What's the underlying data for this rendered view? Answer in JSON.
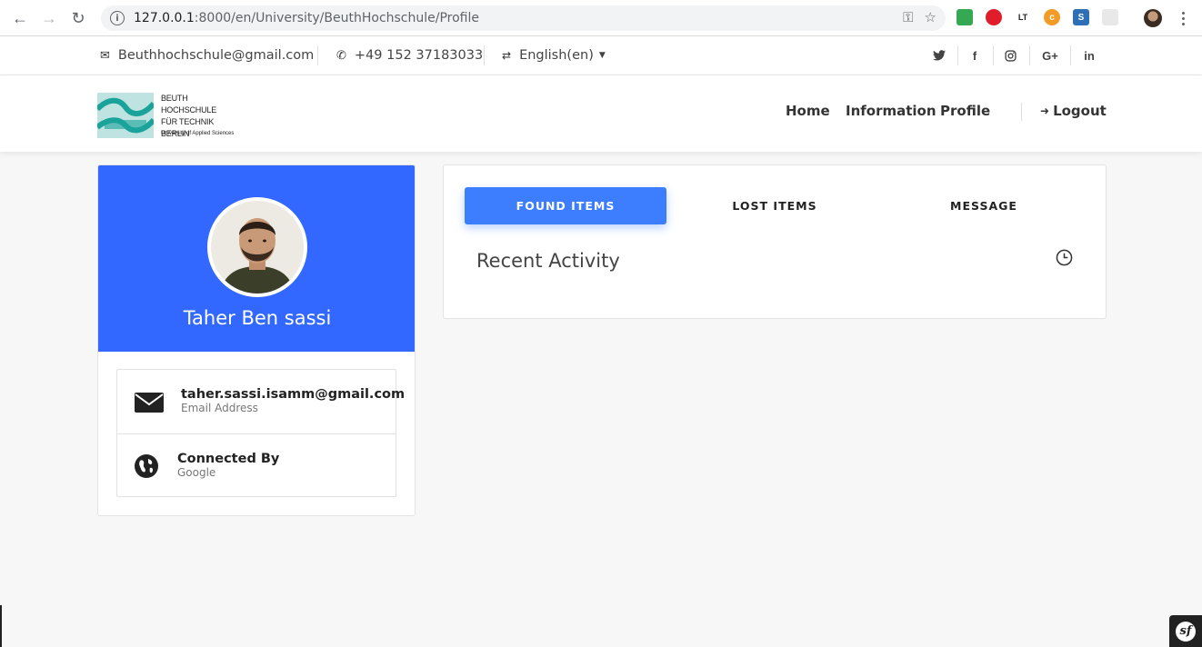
{
  "browser": {
    "url_host": "127.0.0.1",
    "url_path": ":8000/en/University/BeuthHochschule/Profile"
  },
  "topbar": {
    "email": "Beuthhochschule@gmail.com",
    "phone": "+49 152 37183033",
    "language": "English(en)",
    "social": {
      "twitter": "twitter-icon",
      "facebook": "f",
      "instagram": "instagram-icon",
      "google_plus": "G+",
      "linkedin": "in"
    }
  },
  "brand": {
    "line1": "BEUTH HOCHSCHULE",
    "line2": "FÜR TECHNIK",
    "line3": "BERLIN",
    "tagline": "University of Applied Sciences"
  },
  "nav": {
    "home": "Home",
    "information": "Information",
    "profile": "Profile",
    "logout": "Logout"
  },
  "profile": {
    "name": "Taher Ben sassi",
    "email": "taher.sassi.isamm@gmail.com",
    "email_label": "Email Address",
    "connected_title": "Connected By",
    "connected_value": "Google"
  },
  "activity": {
    "tabs": [
      "FOUND ITEMS",
      "LOST ITEMS",
      "MESSAGE"
    ],
    "active_tab": "FOUND ITEMS",
    "title": "Recent Activity"
  },
  "colors": {
    "profile_header": "#3268ff",
    "active_tab": "#3d7dff"
  }
}
